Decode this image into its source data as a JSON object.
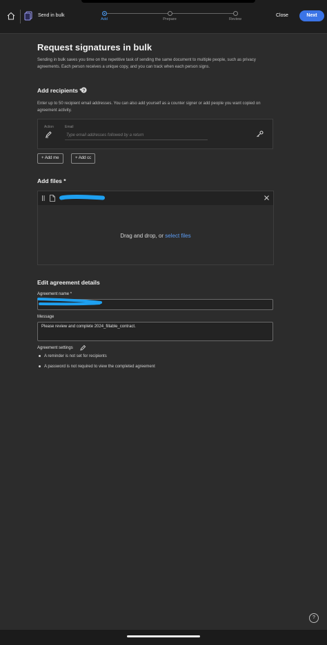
{
  "header": {
    "title": "Send in bulk",
    "steps": [
      {
        "label": "Add",
        "active": true
      },
      {
        "label": "Prepare",
        "active": false
      },
      {
        "label": "Review",
        "active": false
      }
    ],
    "close_label": "Close",
    "next_label": "Next"
  },
  "page": {
    "title": "Request signatures in bulk",
    "intro": "Sending in bulk saves you time on the repetitive task of sending the same document to multiple people, such as privacy agreements. Each person receives a unique copy, and you can track when each person signs."
  },
  "recipients": {
    "title": "Add recipients *",
    "description": "Enter up to 50 recipient email addresses. You can also add yourself as a counter signer or add people you want copied on agreement activity.",
    "action_label": "Action",
    "email_label": "Email",
    "email_placeholder": "Type email addresses followed by a return",
    "add_me_label": "+ Add me",
    "add_cc_label": "+ Add cc"
  },
  "files": {
    "title": "Add files *",
    "drop_text": "Drag and drop, or ",
    "select_link": "select files"
  },
  "details": {
    "title": "Edit agreement details",
    "name_label": "Agreement name *",
    "message_label": "Message",
    "message_value": "Please review and complete 2024_fillable_contract.",
    "settings_label": "Agreement settings",
    "settings": [
      "A reminder is not set for recipients",
      "A password is not required to view the completed agreement"
    ]
  },
  "colors": {
    "accent": "#3b74e6",
    "link": "#5c9df5",
    "redaction": "#1ea0f0"
  }
}
